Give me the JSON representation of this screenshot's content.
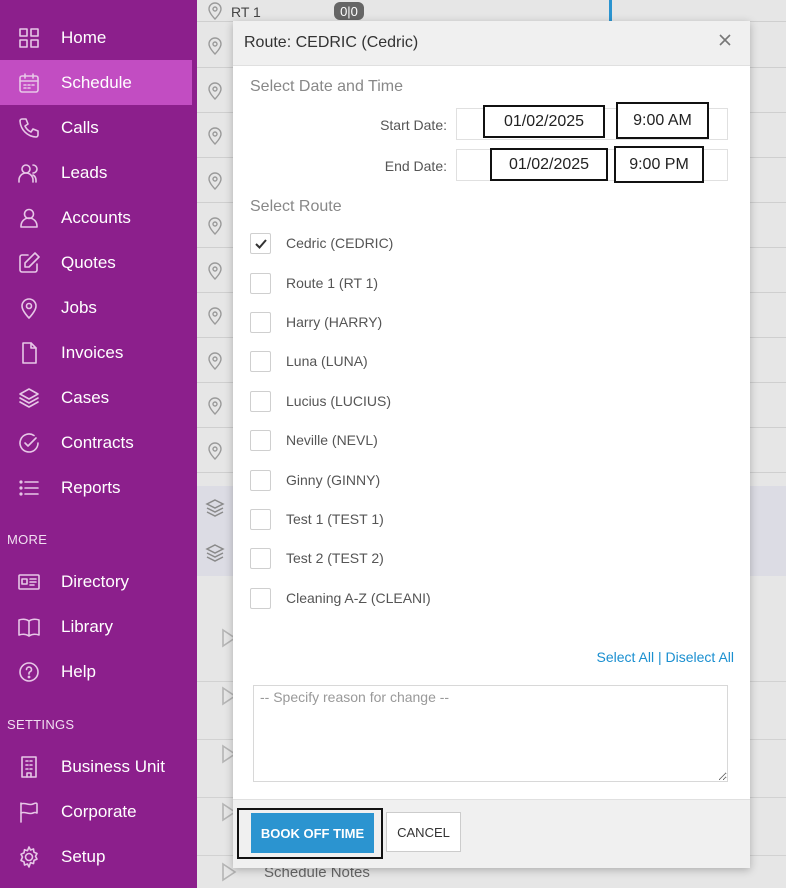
{
  "sidebar": {
    "items": [
      {
        "label": "Home",
        "icon": "home-grid-icon"
      },
      {
        "label": "Schedule",
        "icon": "calendar-icon",
        "active": true
      },
      {
        "label": "Calls",
        "icon": "phone-icon"
      },
      {
        "label": "Leads",
        "icon": "users-icon"
      },
      {
        "label": "Accounts",
        "icon": "user-icon"
      },
      {
        "label": "Quotes",
        "icon": "edit-icon"
      },
      {
        "label": "Jobs",
        "icon": "map-pin-icon"
      },
      {
        "label": "Invoices",
        "icon": "document-icon"
      },
      {
        "label": "Cases",
        "icon": "layers-icon"
      },
      {
        "label": "Contracts",
        "icon": "check-circle-icon"
      },
      {
        "label": "Reports",
        "icon": "list-icon"
      }
    ],
    "more_label": "MORE",
    "more_items": [
      {
        "label": "Directory",
        "icon": "address-card-icon"
      },
      {
        "label": "Library",
        "icon": "book-icon"
      },
      {
        "label": "Help",
        "icon": "help-circle-icon"
      }
    ],
    "settings_label": "SETTINGS",
    "settings_items": [
      {
        "label": "Business Unit",
        "icon": "building-icon"
      },
      {
        "label": "Corporate",
        "icon": "flag-icon"
      },
      {
        "label": "Setup",
        "icon": "gear-icon"
      }
    ],
    "accent": "#8c1f8c",
    "active_color": "#c24dc2"
  },
  "background": {
    "first_route_label": "RT 1",
    "first_route_badge": "0|0",
    "schedule_notes_label": "Schedule Notes"
  },
  "modal": {
    "title": "Route: CEDRIC (Cedric)",
    "section_date": "Select Date and Time",
    "start_label": "Start Date:",
    "start_date": "01/02/2025",
    "start_time": "9:00 AM",
    "end_label": "End Date:",
    "end_date": "01/02/2025",
    "end_time": "9:00 PM",
    "section_route": "Select Route",
    "routes": [
      {
        "label": "Cedric (CEDRIC)",
        "checked": true
      },
      {
        "label": "Route 1 (RT 1)",
        "checked": false
      },
      {
        "label": "Harry (HARRY)",
        "checked": false
      },
      {
        "label": "Luna (LUNA)",
        "checked": false
      },
      {
        "label": "Lucius (LUCIUS)",
        "checked": false
      },
      {
        "label": "Neville (NEVL)",
        "checked": false
      },
      {
        "label": "Ginny (GINNY)",
        "checked": false
      },
      {
        "label": "Test 1 (TEST 1)",
        "checked": false
      },
      {
        "label": "Test 2 (TEST 2)",
        "checked": false
      },
      {
        "label": "Cleaning A-Z (CLEANI)",
        "checked": false
      }
    ],
    "select_all": "Select All",
    "separator": " | ",
    "deselect_all": "Diselect All",
    "reason_placeholder": "-- Specify reason for change --",
    "book_label": "BOOK OFF TIME",
    "cancel_label": "CANCEL",
    "book_color": "#2b94d0"
  }
}
